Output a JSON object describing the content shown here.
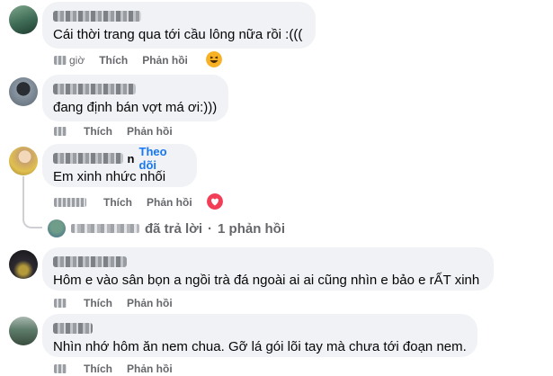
{
  "comments": [
    {
      "text": "Cái thời trang qua tới cầu lông nữa rồi :(((",
      "time": "giờ",
      "like": "Thích",
      "reply": "Phản hồi",
      "reaction": "haha"
    },
    {
      "text": "đang định bán vợt má ơi:)))",
      "time": "",
      "like": "Thích",
      "reply": "Phản hồi"
    },
    {
      "name_suffix": "n",
      "follow": "Theo dõi",
      "text": "Em xinh nhức nhối",
      "time": "",
      "like": "Thích",
      "reply": "Phản hồi",
      "reaction": "love"
    },
    {
      "text": "Hôm e vào sân bọn a ngồi trà đá ngoài ai ai cũng nhìn e bảo e rẤT xinh",
      "time": "",
      "like": "Thích",
      "reply": "Phản hồi"
    },
    {
      "text": "Nhìn nhớ hôm ăn nem chua. Gỡ lá gói lõi tay mà chưa tới đoạn nem.",
      "time": "",
      "like": "Thích",
      "reply": "Phản hồi"
    }
  ],
  "reply_summary": {
    "replied": "đã trả lời",
    "separator": "·",
    "count": "1 phản hồi"
  },
  "colors": {
    "bubble": "#f0f2f5",
    "meta": "#65676b",
    "link": "#1877f2",
    "love": "#f33e58",
    "haha": "#f7b125"
  }
}
